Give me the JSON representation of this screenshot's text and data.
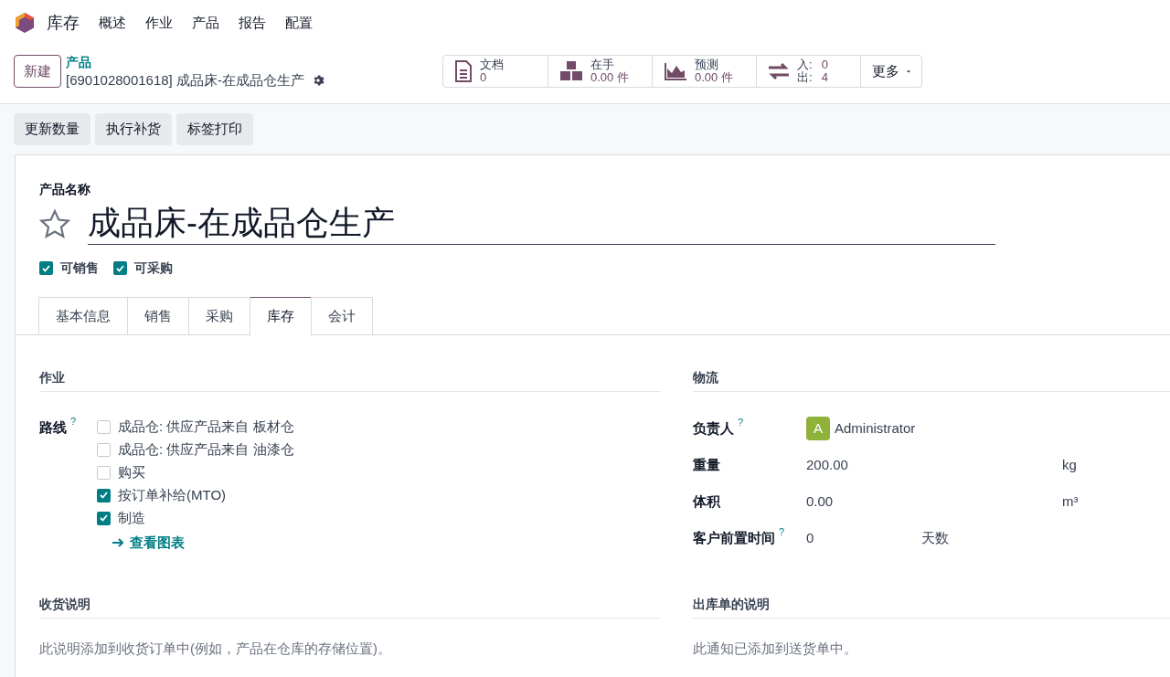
{
  "app": {
    "name": "库存"
  },
  "menu": [
    "概述",
    "作业",
    "产品",
    "报告",
    "配置"
  ],
  "breadcrumb": {
    "new_button": "新建",
    "parent": "产品",
    "current": "[6901028001618] 成品床-在成品仓生产"
  },
  "stat_buttons": [
    {
      "kind": "doc",
      "label": "文档",
      "value": "0"
    },
    {
      "kind": "onhand",
      "label": "在手",
      "value": "0.00 件"
    },
    {
      "kind": "forecast",
      "label": "预测",
      "value": "0.00 件"
    },
    {
      "kind": "inout",
      "in_label": "入:",
      "in_value": "0",
      "out_label": "出:",
      "out_value": "4"
    },
    {
      "kind": "more",
      "label": "更多"
    }
  ],
  "actions": [
    "更新数量",
    "执行补货",
    "标签打印"
  ],
  "form": {
    "name_label": "产品名称",
    "name": "成品床-在成品仓生产",
    "favorite": false,
    "flags": [
      {
        "label": "可销售",
        "checked": true
      },
      {
        "label": "可采购",
        "checked": true
      }
    ],
    "tabs": [
      {
        "label": "基本信息",
        "selected": false
      },
      {
        "label": "销售",
        "selected": false
      },
      {
        "label": "采购",
        "selected": false
      },
      {
        "label": "库存",
        "selected": true
      },
      {
        "label": "会计",
        "selected": false
      }
    ],
    "operations": {
      "title": "作业",
      "routes_label": "路线",
      "help": "?",
      "routes": [
        {
          "label": "成品仓: 供应产品来自 板材仓",
          "checked": false
        },
        {
          "label": "成品仓: 供应产品来自 油漆仓",
          "checked": false
        },
        {
          "label": "购买",
          "checked": false
        },
        {
          "label": "按订单补给(MTO)",
          "checked": true
        },
        {
          "label": "制造",
          "checked": true
        }
      ],
      "link": "查看图表"
    },
    "logistics": {
      "title": "物流",
      "fields": [
        {
          "kind": "user",
          "label": "负责人",
          "help": "?",
          "avatar": "A",
          "value": "Administrator"
        },
        {
          "kind": "unit",
          "label": "重量",
          "value": "200.00",
          "unit": "kg"
        },
        {
          "kind": "unit",
          "label": "体积",
          "value": "0.00",
          "unit": "m³"
        },
        {
          "kind": "days",
          "label": "客户前置时间",
          "help": "?",
          "value": "0",
          "unit": "天数"
        }
      ]
    },
    "receipt_note": {
      "title": "收货说明",
      "placeholder": "此说明添加到收货订单中(例如，产品在仓库的存储位置)。"
    },
    "delivery_note": {
      "title": "出库单的说明",
      "placeholder": "此通知已添加到送货单中。"
    }
  }
}
